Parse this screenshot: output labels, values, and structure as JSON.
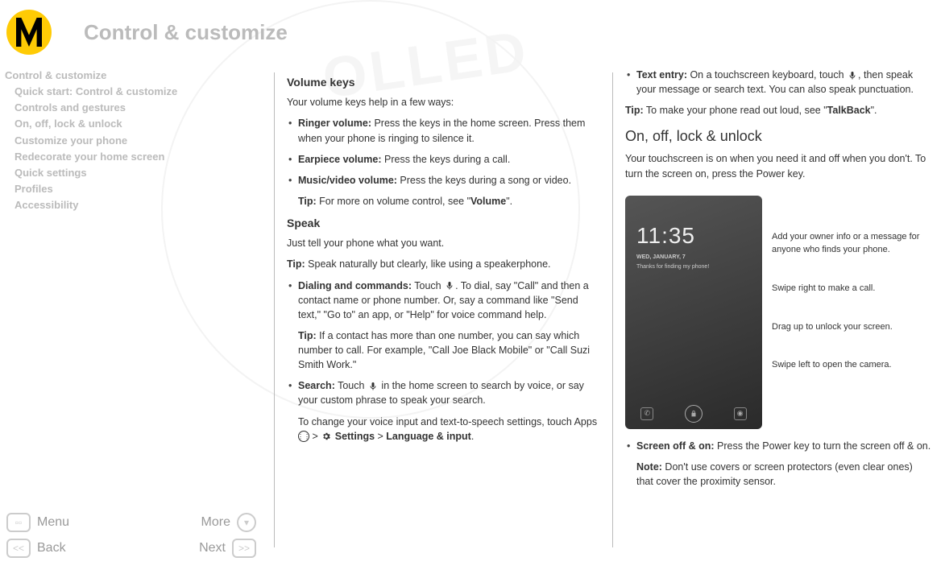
{
  "header": {
    "title": "Control & customize"
  },
  "sidebar": {
    "items": [
      {
        "label": "Control & customize"
      },
      {
        "label": "Quick start: Control & customize"
      },
      {
        "label": "Controls and gestures"
      },
      {
        "label": "On, off, lock & unlock"
      },
      {
        "label": "Customize your phone"
      },
      {
        "label": "Redecorate your home screen"
      },
      {
        "label": "Quick settings"
      },
      {
        "label": "Profiles"
      },
      {
        "label": "Accessibility"
      }
    ]
  },
  "nav": {
    "menu": "Menu",
    "more": "More",
    "back": "Back",
    "next": "Next"
  },
  "col1": {
    "h_volume": "Volume keys",
    "p_volume_intro": "Your volume keys help in a few ways:",
    "li_ringer_b": "Ringer volume:",
    "li_ringer_t": " Press the keys in the home screen. Press them when your phone is ringing to silence it.",
    "li_ear_b": "Earpiece volume:",
    "li_ear_t": " Press the keys during a call.",
    "li_music_b": "Music/video volume:",
    "li_music_t": " Press the keys during a song or video.",
    "tip_vol_b": "Tip:",
    "tip_vol_t": " For more on volume control, see \"",
    "tip_vol_link": "Volume",
    "tip_vol_end": "\".",
    "h_speak": "Speak",
    "p_speak_intro": "Just tell your phone what you want.",
    "tip_speak_b": "Tip:",
    "tip_speak_t": " Speak naturally but clearly, like using a speakerphone.",
    "li_dial_b": "Dialing and commands:",
    "li_dial_t1": " Touch ",
    "li_dial_t2": ". To dial, say \"Call\" and then a contact name or phone number. Or, say a command like \"Send text,\" \"Go to\" an app, or \"Help\" for voice command help.",
    "tip_dial_b": "Tip:",
    "tip_dial_t": " If a contact has more than one number, you can say which number to call. For example, \"Call Joe Black Mobile\" or \"Call Suzi Smith Work.\"",
    "li_search_b": "Search:",
    "li_search_t1": " Touch ",
    "li_search_t2": " in the home screen to search by voice, or say your custom phrase to speak your search.",
    "p_voiceinput_t1": "To change your voice input and text-to-speech settings, touch Apps ",
    "p_voiceinput_settings": "Settings",
    "p_voiceinput_arrow": " > ",
    "p_voiceinput_lang": "Language & input",
    "p_voiceinput_end": "."
  },
  "col2": {
    "li_text_b": "Text entry:",
    "li_text_t1": " On a touchscreen keyboard, touch ",
    "li_text_t2": ", then speak your message or search text. You can also speak punctuation.",
    "tip_tb_b": "Tip:",
    "tip_tb_t": " To make your phone read out loud, see \"",
    "tip_tb_link": "TalkBack",
    "tip_tb_end": "\".",
    "h_onoff": "On, off, lock & unlock",
    "p_onoff": "Your touchscreen is on when you need it and off when you don't. To turn the screen on, press the Power key.",
    "phone": {
      "time": "11:35",
      "date": "WED, JANUARY, 7",
      "msg": "Thanks for finding my phone!"
    },
    "annot1": "Add your owner info or a message for anyone who finds your phone.",
    "annot2": "Swipe right to make a call.",
    "annot3": "Drag up to unlock your screen.",
    "annot4": "Swipe left to open the camera.",
    "li_screen_b": "Screen off & on:",
    "li_screen_t": " Press the Power key to turn the screen off & on.",
    "note_b": "Note:",
    "note_t": " Don't use covers or screen protectors (even clear ones) that cover the proximity sensor."
  }
}
